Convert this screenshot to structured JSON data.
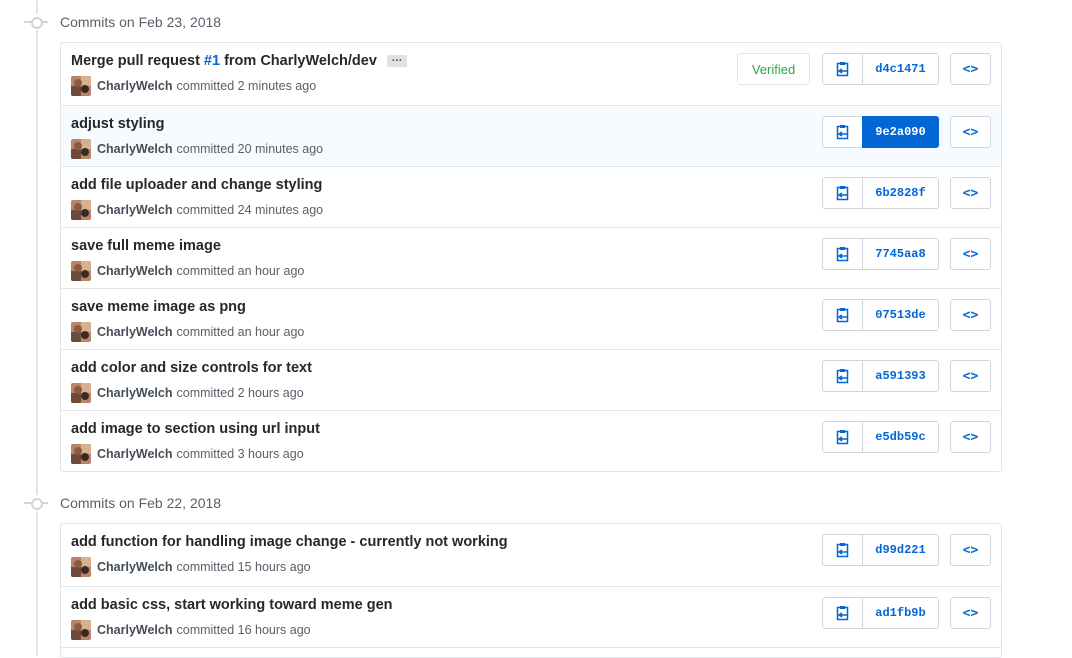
{
  "colors": {
    "link": "#0366d6",
    "verified": "#28a745",
    "highlight": "#f6fbff"
  },
  "groups": [
    {
      "header": "Commits on Feb 23, 2018",
      "commits": [
        {
          "title_pre": "Merge pull request ",
          "ref": "#1",
          "title_post": " from CharlyWelch/dev",
          "author": "CharlyWelch",
          "when": "committed 2 minutes ago",
          "sha": "d4c1471",
          "verified": "Verified",
          "has_ellipsis": true,
          "ellipsis": "…"
        },
        {
          "title_pre": "adjust styling",
          "author": "CharlyWelch",
          "when": "committed 20 minutes ago",
          "sha": "9e2a090",
          "active": true
        },
        {
          "title_pre": "add file uploader and change styling",
          "author": "CharlyWelch",
          "when": "committed 24 minutes ago",
          "sha": "6b2828f"
        },
        {
          "title_pre": "save full meme image",
          "author": "CharlyWelch",
          "when": "committed an hour ago",
          "sha": "7745aa8"
        },
        {
          "title_pre": "save meme image as png",
          "author": "CharlyWelch",
          "when": "committed an hour ago",
          "sha": "07513de"
        },
        {
          "title_pre": "add color and size controls for text",
          "author": "CharlyWelch",
          "when": "committed 2 hours ago",
          "sha": "a591393"
        },
        {
          "title_pre": "add image to section using url input",
          "author": "CharlyWelch",
          "when": "committed 3 hours ago",
          "sha": "e5db59c"
        }
      ]
    },
    {
      "header": "Commits on Feb 22, 2018",
      "commits": [
        {
          "title_pre": "add function for handling image change - currently not working",
          "author": "CharlyWelch",
          "when": "committed 15 hours ago",
          "sha": "d99d221"
        },
        {
          "title_pre": "add basic css, start working toward meme gen",
          "author": "CharlyWelch",
          "when": "committed 16 hours ago",
          "sha": "ad1fb9b"
        },
        {
          "title_pre": "",
          "author": "",
          "when": "",
          "sha": ""
        }
      ]
    }
  ],
  "icons": {
    "copy": "clippy-icon",
    "browse": "code-icon",
    "node": "commit-node-icon",
    "avatar": "avatar"
  },
  "browse_glyph": "<>"
}
